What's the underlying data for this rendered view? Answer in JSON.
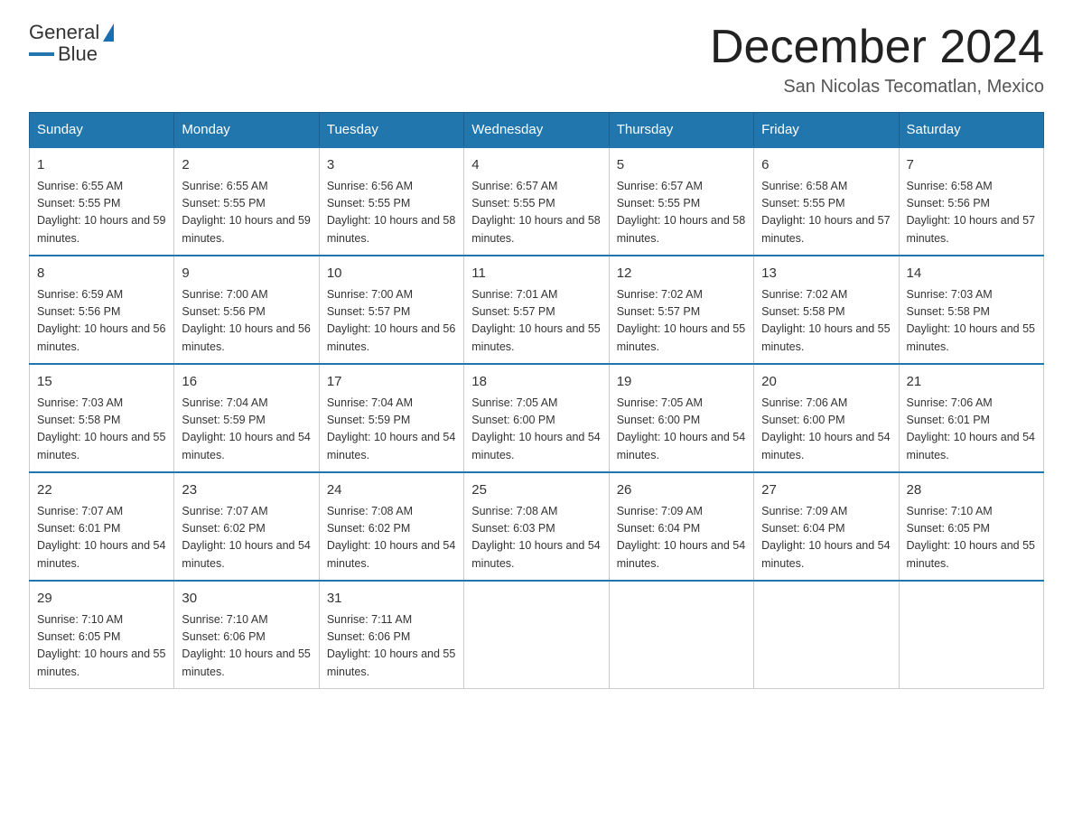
{
  "header": {
    "logo_text_general": "General",
    "logo_text_blue": "Blue",
    "month_title": "December 2024",
    "location": "San Nicolas Tecomatlan, Mexico"
  },
  "weekdays": [
    "Sunday",
    "Monday",
    "Tuesday",
    "Wednesday",
    "Thursday",
    "Friday",
    "Saturday"
  ],
  "weeks": [
    [
      {
        "day": "1",
        "sunrise": "6:55 AM",
        "sunset": "5:55 PM",
        "daylight": "10 hours and 59 minutes."
      },
      {
        "day": "2",
        "sunrise": "6:55 AM",
        "sunset": "5:55 PM",
        "daylight": "10 hours and 59 minutes."
      },
      {
        "day": "3",
        "sunrise": "6:56 AM",
        "sunset": "5:55 PM",
        "daylight": "10 hours and 58 minutes."
      },
      {
        "day": "4",
        "sunrise": "6:57 AM",
        "sunset": "5:55 PM",
        "daylight": "10 hours and 58 minutes."
      },
      {
        "day": "5",
        "sunrise": "6:57 AM",
        "sunset": "5:55 PM",
        "daylight": "10 hours and 58 minutes."
      },
      {
        "day": "6",
        "sunrise": "6:58 AM",
        "sunset": "5:55 PM",
        "daylight": "10 hours and 57 minutes."
      },
      {
        "day": "7",
        "sunrise": "6:58 AM",
        "sunset": "5:56 PM",
        "daylight": "10 hours and 57 minutes."
      }
    ],
    [
      {
        "day": "8",
        "sunrise": "6:59 AM",
        "sunset": "5:56 PM",
        "daylight": "10 hours and 56 minutes."
      },
      {
        "day": "9",
        "sunrise": "7:00 AM",
        "sunset": "5:56 PM",
        "daylight": "10 hours and 56 minutes."
      },
      {
        "day": "10",
        "sunrise": "7:00 AM",
        "sunset": "5:57 PM",
        "daylight": "10 hours and 56 minutes."
      },
      {
        "day": "11",
        "sunrise": "7:01 AM",
        "sunset": "5:57 PM",
        "daylight": "10 hours and 55 minutes."
      },
      {
        "day": "12",
        "sunrise": "7:02 AM",
        "sunset": "5:57 PM",
        "daylight": "10 hours and 55 minutes."
      },
      {
        "day": "13",
        "sunrise": "7:02 AM",
        "sunset": "5:58 PM",
        "daylight": "10 hours and 55 minutes."
      },
      {
        "day": "14",
        "sunrise": "7:03 AM",
        "sunset": "5:58 PM",
        "daylight": "10 hours and 55 minutes."
      }
    ],
    [
      {
        "day": "15",
        "sunrise": "7:03 AM",
        "sunset": "5:58 PM",
        "daylight": "10 hours and 55 minutes."
      },
      {
        "day": "16",
        "sunrise": "7:04 AM",
        "sunset": "5:59 PM",
        "daylight": "10 hours and 54 minutes."
      },
      {
        "day": "17",
        "sunrise": "7:04 AM",
        "sunset": "5:59 PM",
        "daylight": "10 hours and 54 minutes."
      },
      {
        "day": "18",
        "sunrise": "7:05 AM",
        "sunset": "6:00 PM",
        "daylight": "10 hours and 54 minutes."
      },
      {
        "day": "19",
        "sunrise": "7:05 AM",
        "sunset": "6:00 PM",
        "daylight": "10 hours and 54 minutes."
      },
      {
        "day": "20",
        "sunrise": "7:06 AM",
        "sunset": "6:00 PM",
        "daylight": "10 hours and 54 minutes."
      },
      {
        "day": "21",
        "sunrise": "7:06 AM",
        "sunset": "6:01 PM",
        "daylight": "10 hours and 54 minutes."
      }
    ],
    [
      {
        "day": "22",
        "sunrise": "7:07 AM",
        "sunset": "6:01 PM",
        "daylight": "10 hours and 54 minutes."
      },
      {
        "day": "23",
        "sunrise": "7:07 AM",
        "sunset": "6:02 PM",
        "daylight": "10 hours and 54 minutes."
      },
      {
        "day": "24",
        "sunrise": "7:08 AM",
        "sunset": "6:02 PM",
        "daylight": "10 hours and 54 minutes."
      },
      {
        "day": "25",
        "sunrise": "7:08 AM",
        "sunset": "6:03 PM",
        "daylight": "10 hours and 54 minutes."
      },
      {
        "day": "26",
        "sunrise": "7:09 AM",
        "sunset": "6:04 PM",
        "daylight": "10 hours and 54 minutes."
      },
      {
        "day": "27",
        "sunrise": "7:09 AM",
        "sunset": "6:04 PM",
        "daylight": "10 hours and 54 minutes."
      },
      {
        "day": "28",
        "sunrise": "7:10 AM",
        "sunset": "6:05 PM",
        "daylight": "10 hours and 55 minutes."
      }
    ],
    [
      {
        "day": "29",
        "sunrise": "7:10 AM",
        "sunset": "6:05 PM",
        "daylight": "10 hours and 55 minutes."
      },
      {
        "day": "30",
        "sunrise": "7:10 AM",
        "sunset": "6:06 PM",
        "daylight": "10 hours and 55 minutes."
      },
      {
        "day": "31",
        "sunrise": "7:11 AM",
        "sunset": "6:06 PM",
        "daylight": "10 hours and 55 minutes."
      },
      null,
      null,
      null,
      null
    ]
  ]
}
